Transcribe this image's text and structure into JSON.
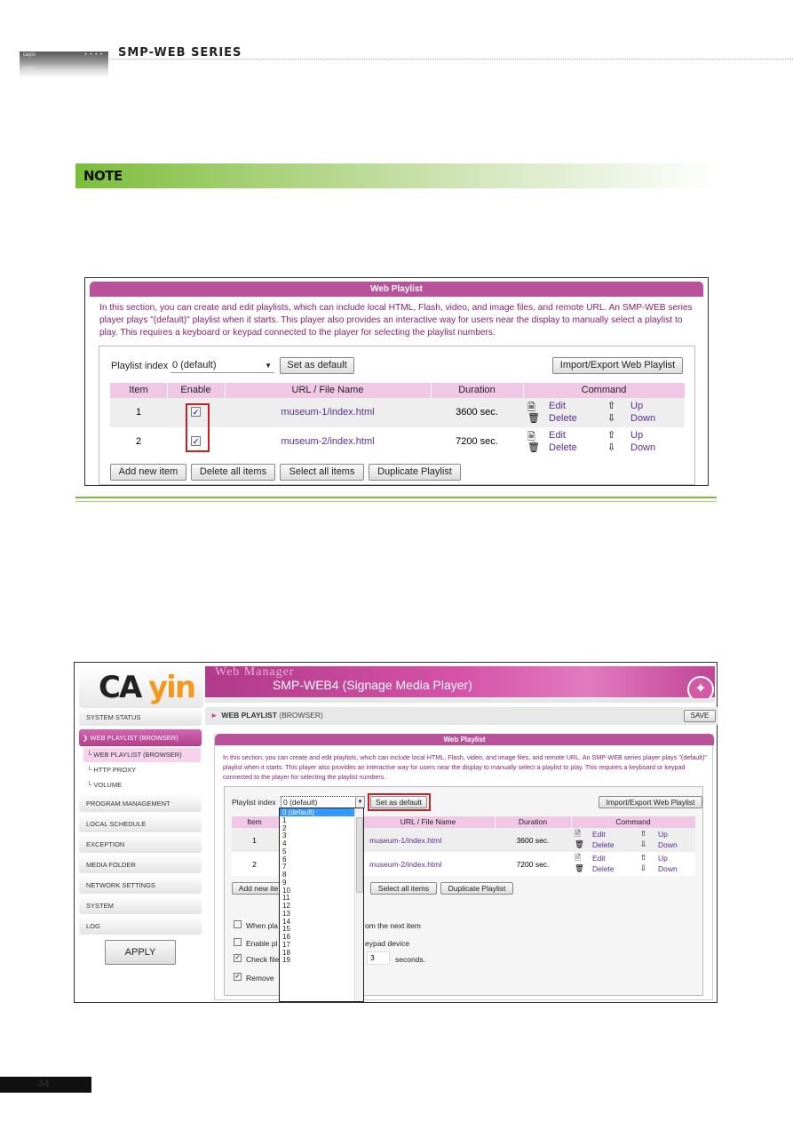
{
  "header": {
    "tab_line1": "cayin",
    "tab_line2": "cayin",
    "tab_dots": "• • • •",
    "series_title": "SMP-WEB SERIES"
  },
  "note": {
    "label": "NOTE"
  },
  "panel": {
    "title": "Web Playlist",
    "description": "In this section, you can create and edit playlists, which can include local HTML, Flash, video, and image files, and remote URL. An SMP-WEB series player plays \"(default)\" playlist when it starts. This player also provides an interactive way for users near the display to manually select a playlist to play. This requires a keyboard or keypad connected to the player for selecting the playlist numbers.",
    "playlist_index_label": "Playlist index",
    "playlist_index_value": "0 (default)",
    "set_default_label": "Set as default",
    "import_export_label": "Import/Export Web Playlist",
    "columns": [
      "Item",
      "Enable",
      "URL / File Name",
      "Duration",
      "Command"
    ],
    "rows": [
      {
        "item": "1",
        "enabled": true,
        "url": "museum-1/index.html",
        "duration": "3600 sec.",
        "edit": "Edit",
        "delete": "Delete",
        "up": "Up",
        "down": "Down"
      },
      {
        "item": "2",
        "enabled": true,
        "url": "museum-2/index.html",
        "duration": "7200 sec.",
        "edit": "Edit",
        "delete": "Delete",
        "up": "Up",
        "down": "Down"
      }
    ],
    "buttons": {
      "add": "Add new item",
      "delete_all": "Delete all items",
      "select_all": "Select all items",
      "duplicate": "Duplicate Playlist"
    },
    "checkmark": "✓"
  },
  "manager": {
    "logo_left": "CA",
    "logo_right": "yin",
    "banner_title": "Web Manager",
    "banner_model": "SMP-WEB4 (Signage Media Player)",
    "breadcrumb_bold": "WEB PLAYLIST",
    "breadcrumb_rest": " (BROWSER)",
    "save_label": "SAVE",
    "apply_label": "APPLY",
    "sidebar": [
      {
        "label": "SYSTEM STATUS"
      },
      {
        "label": "WEB PLAYLIST (BROWSER)",
        "active": true
      },
      {
        "label": "PROGRAM MANAGEMENT"
      },
      {
        "label": "LOCAL SCHEDULE"
      },
      {
        "label": "EXCEPTION"
      },
      {
        "label": "MEDIA FOLDER"
      },
      {
        "label": "NETWORK SETTINGS"
      },
      {
        "label": "SYSTEM"
      },
      {
        "label": "LOG"
      }
    ],
    "sub_items": [
      {
        "label": "└ WEB PLAYLIST (BROWSER)",
        "active": true
      },
      {
        "label": "└ HTTP PROXY"
      },
      {
        "label": "└ VOLUME"
      }
    ],
    "add_button_partial": "Add new ite",
    "options": [
      {
        "label_left": "When pla",
        "label_right": "om the next item",
        "checked": false
      },
      {
        "label_left": "Enable pl",
        "label_right": "eypad device",
        "checked": false
      },
      {
        "label_left": "Check file",
        "label_right": "seconds.",
        "checked": true,
        "input_value": "3"
      },
      {
        "label_left": "Remove",
        "label_right": "",
        "checked": true
      }
    ],
    "dropdown_options": [
      "0 (default)",
      "1",
      "2",
      "3",
      "4",
      "5",
      "6",
      "7",
      "8",
      "9",
      "10",
      "11",
      "12",
      "13",
      "14",
      "15",
      "16",
      "17",
      "18",
      "19"
    ],
    "dropdown_selected": "0 (default)"
  },
  "page_number": "34"
}
